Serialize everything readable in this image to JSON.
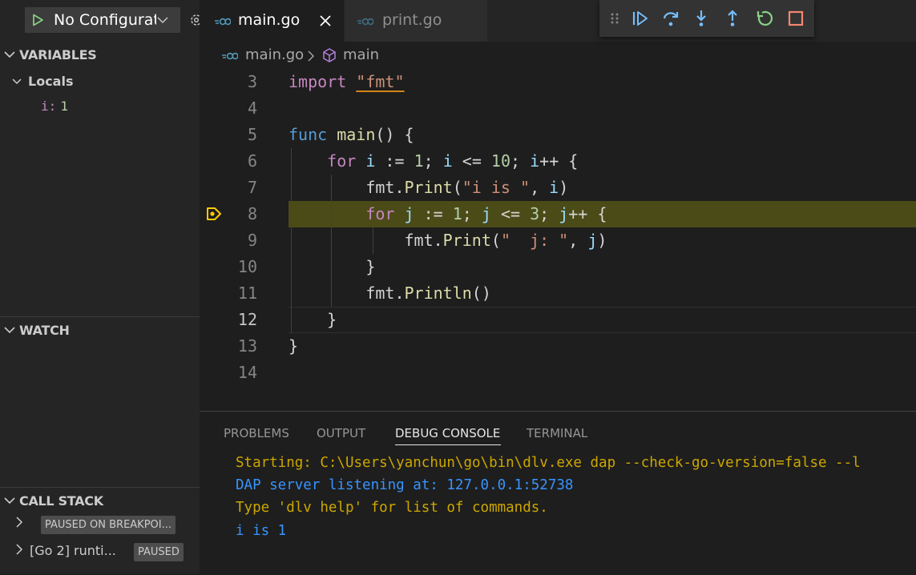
{
  "run": {
    "config_label": "No Configurat"
  },
  "sidebar": {
    "variables": {
      "title": "VARIABLES",
      "locals_label": "Locals",
      "vars": [
        {
          "name": "i:",
          "value": "1"
        }
      ]
    },
    "watch": {
      "title": "WATCH"
    },
    "call_stack": {
      "title": "CALL STACK",
      "rows": [
        {
          "label": "",
          "badge": "PAUSED ON BREAKPOI..."
        },
        {
          "label": "[Go 2] runti...",
          "badge": "PAUSED"
        }
      ]
    }
  },
  "tabs": [
    {
      "label": "main.go",
      "active": true
    },
    {
      "label": "print.go",
      "active": false
    }
  ],
  "breadcrumbs": {
    "file": "main.go",
    "symbol": "main"
  },
  "code": {
    "lines": [
      {
        "num": "3",
        "text": "import \"fmt\""
      },
      {
        "num": "4",
        "text": ""
      },
      {
        "num": "5",
        "text": "func main() {"
      },
      {
        "num": "6",
        "text": "    for i := 1; i <= 10; i++ {"
      },
      {
        "num": "7",
        "text": "        fmt.Print(\"i is \", i)"
      },
      {
        "num": "8",
        "text": "        for j := 1; j <= 3; j++ {"
      },
      {
        "num": "9",
        "text": "            fmt.Print(\"  j: \", j)"
      },
      {
        "num": "10",
        "text": "        }"
      },
      {
        "num": "11",
        "text": "        fmt.Println()"
      },
      {
        "num": "12",
        "text": "    }"
      },
      {
        "num": "13",
        "text": "}"
      },
      {
        "num": "14",
        "text": ""
      }
    ],
    "paused_line": "8",
    "cursor_line": "12"
  },
  "panel": {
    "tabs": [
      {
        "label": "PROBLEMS",
        "active": false
      },
      {
        "label": "OUTPUT",
        "active": false
      },
      {
        "label": "DEBUG CONSOLE",
        "active": true
      },
      {
        "label": "TERMINAL",
        "active": false
      }
    ],
    "console": [
      {
        "text": "Starting: C:\\Users\\yanchun\\go\\bin\\dlv.exe dap --check-go-version=false --l",
        "color": "orange"
      },
      {
        "text": "DAP server listening at: 127.0.0.1:52738",
        "color": "blue"
      },
      {
        "text": "Type 'dlv help' for list of commands.",
        "color": "orange"
      },
      {
        "text": "i is 1",
        "color": "blue"
      }
    ]
  },
  "colors": {
    "accent_blue": "#3794ff",
    "debug_highlight": "#4b4b18",
    "breakpoint_yellow": "#ffcc00",
    "go_cyan": "#519aba",
    "continue_blue": "#75beff",
    "restart_green": "#89d185",
    "stop_red": "#f48771"
  },
  "icons": {
    "run": "play-icon",
    "config": "gear-icon",
    "file": "go-file-icon",
    "symbol": "cube-icon",
    "debug_actions": [
      "drag-handle-icon",
      "continue-icon",
      "step-over-icon",
      "step-into-icon",
      "step-out-icon",
      "restart-icon",
      "stop-icon"
    ]
  }
}
